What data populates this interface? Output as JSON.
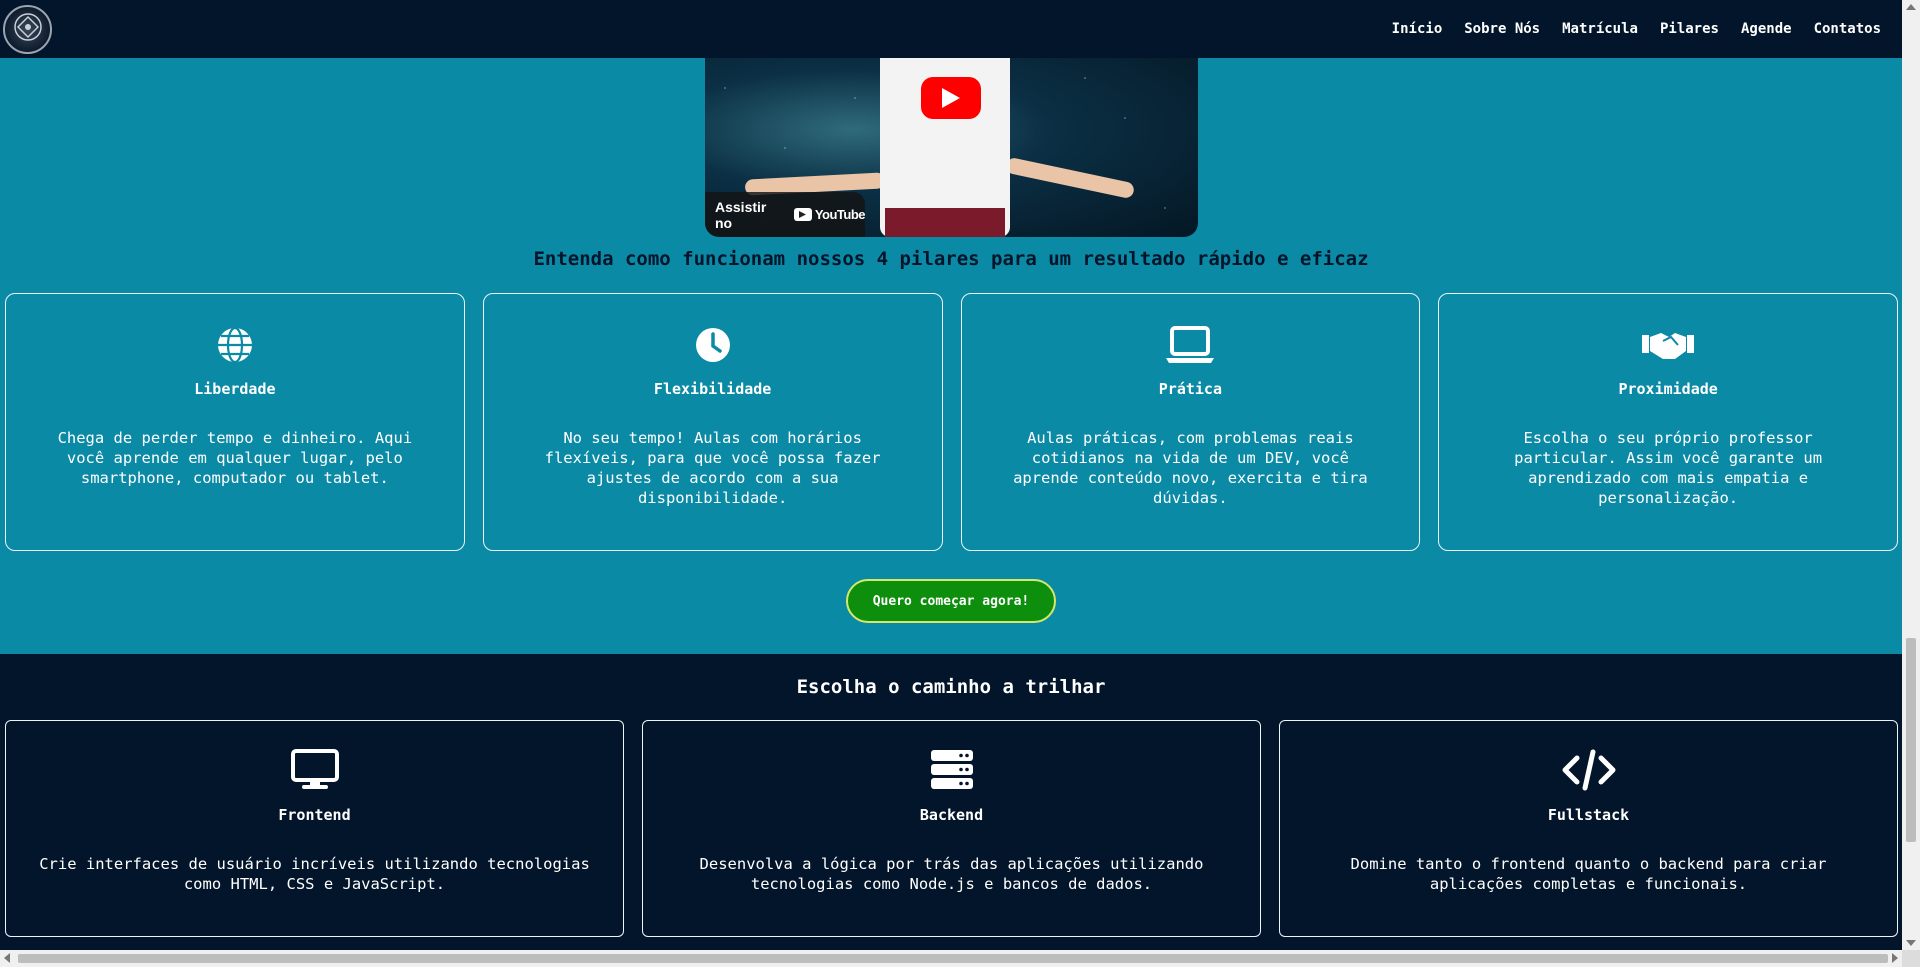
{
  "nav": {
    "logo_icon": "academy-emblem-icon",
    "items": [
      {
        "label": "Início"
      },
      {
        "label": "Sobre Nós"
      },
      {
        "label": "Matrícula"
      },
      {
        "label": "Pilares"
      },
      {
        "label": "Agende"
      },
      {
        "label": "Contatos"
      }
    ]
  },
  "video": {
    "watch_label": "Assistir no",
    "platform": "YouTube",
    "play_icon": "play-icon"
  },
  "pillars": {
    "heading": "Entenda como funcionam nossos 4 pilares para um resultado rápido e eficaz",
    "cards": [
      {
        "icon": "globe-icon",
        "title": "Liberdade",
        "text": "Chega de perder tempo e dinheiro. Aqui você aprende em qualquer lugar, pelo smartphone, computador ou tablet."
      },
      {
        "icon": "clock-icon",
        "title": "Flexibilidade",
        "text": "No seu tempo! Aulas com horários flexíveis, para que você possa fazer ajustes de acordo com a sua disponibilidade."
      },
      {
        "icon": "laptop-icon",
        "title": "Prática",
        "text": "Aulas práticas, com problemas reais cotidianos na vida de um DEV, você aprende conteúdo novo, exercita e tira dúvidas."
      },
      {
        "icon": "handshake-icon",
        "title": "Proximidade",
        "text": "Escolha o seu próprio professor particular. Assim você garante um aprendizado com mais empatia e personalização."
      }
    ],
    "cta_label": "Quero começar agora!"
  },
  "paths": {
    "heading": "Escolha o caminho a trilhar",
    "cards": [
      {
        "icon": "desktop-icon",
        "title": "Frontend",
        "text": "Crie interfaces de usuário incríveis utilizando tecnologias como HTML, CSS e JavaScript."
      },
      {
        "icon": "server-icon",
        "title": "Backend",
        "text": "Desenvolva a lógica por trás das aplicações utilizando tecnologias como Node.js e bancos de dados."
      },
      {
        "icon": "code-icon",
        "title": "Fullstack",
        "text": "Domine tanto o frontend quanto o backend para criar aplicações completas e funcionais."
      }
    ]
  },
  "colors": {
    "header_bg": "#03152a",
    "teal_bg": "#0b8aa6",
    "cta_bg": "#0d8f0d",
    "cta_border": "#d6e86b"
  }
}
